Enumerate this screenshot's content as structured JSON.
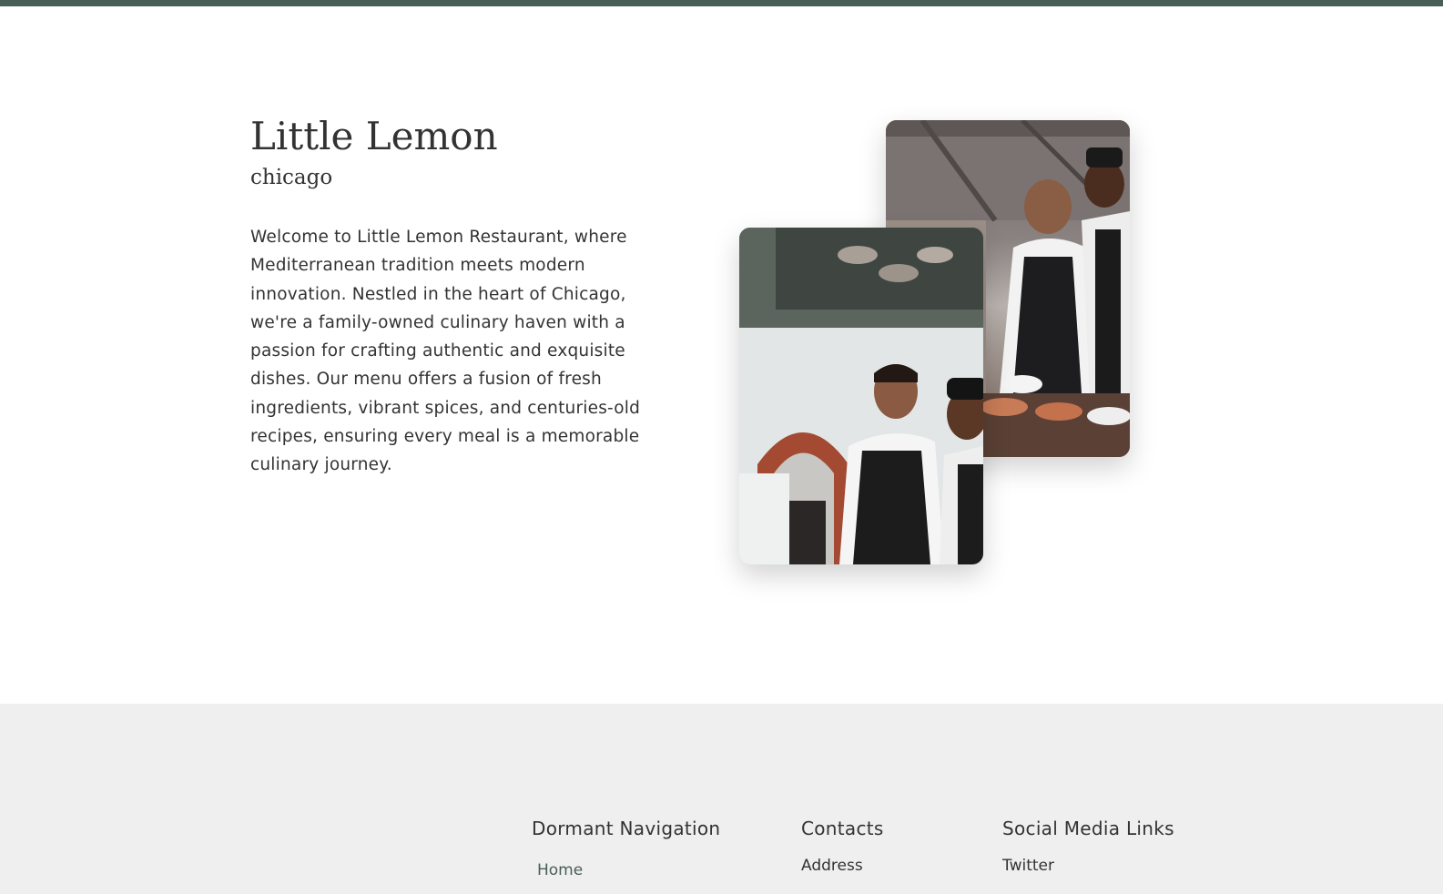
{
  "colors": {
    "primary_green": "#495e57",
    "footer_bg": "#efefef",
    "text": "#333333"
  },
  "about": {
    "title": "Little Lemon",
    "subtitle": "chicago",
    "description": "Welcome to Little Lemon Restaurant, where Mediterranean tradition meets modern innovation. Nestled in the heart of Chicago, we're a family-owned culinary haven with a passion for crafting authentic and exquisite dishes. Our menu offers a fusion of fresh ingredients, vibrant spices, and centuries-old recipes, ensuring every meal is a memorable culinary journey.",
    "images": {
      "back": "chefs-plating-photo",
      "front": "chefs-laughing-photo"
    }
  },
  "footer": {
    "navigation": {
      "heading": "Dormant Navigation",
      "links": [
        "Home"
      ]
    },
    "contacts": {
      "heading": "Contacts",
      "links": [
        "Address"
      ]
    },
    "social": {
      "heading": "Social Media Links",
      "links": [
        "Twitter"
      ]
    }
  }
}
